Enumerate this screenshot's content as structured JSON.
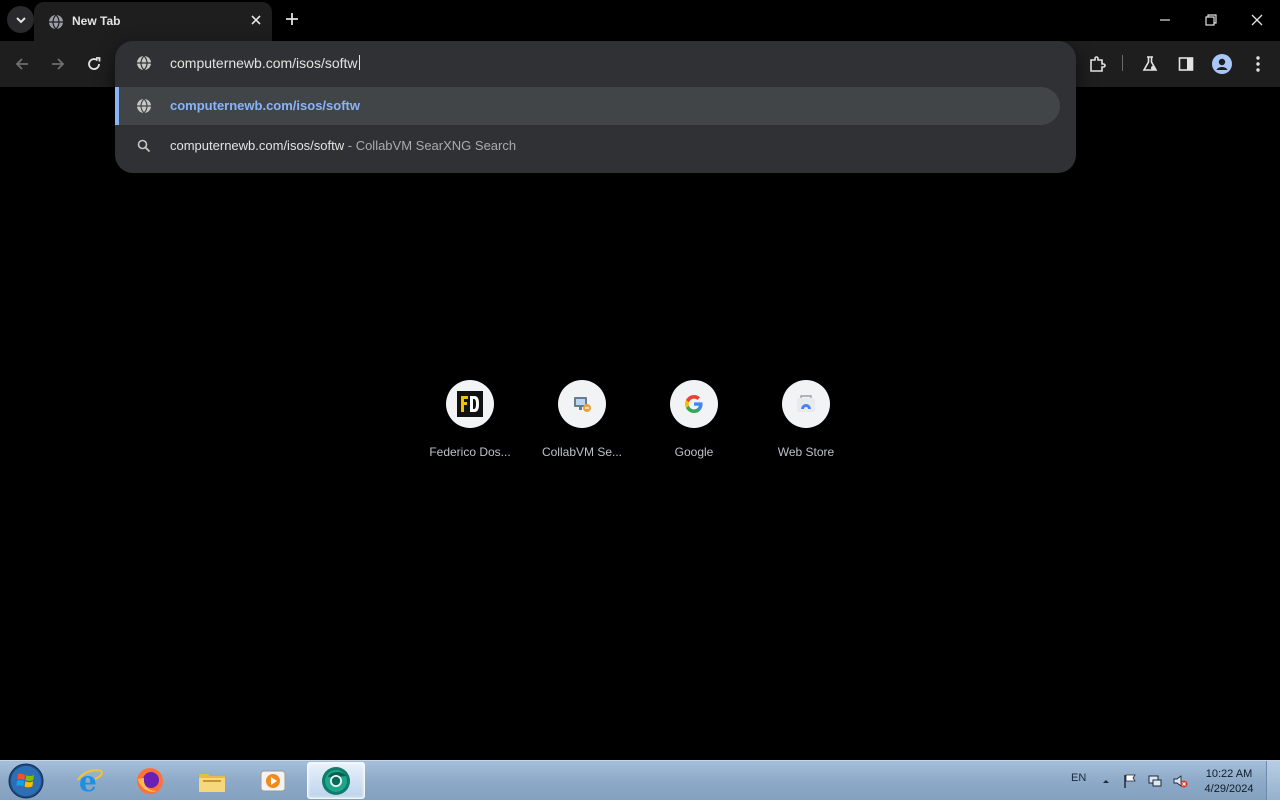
{
  "browser": {
    "tab": {
      "title": "New Tab",
      "favicon": "globe-icon"
    },
    "omnibox": {
      "typed_text": "computernewb.com/isos/softw",
      "suggestions": [
        {
          "kind": "url",
          "icon": "globe-icon",
          "text": "computernewb.com/isos/softw",
          "selected": true
        },
        {
          "kind": "search",
          "icon": "search-icon",
          "text": "computernewb.com/isos/softw",
          "separator": " - ",
          "description": "CollabVM SearXNG Search",
          "selected": false
        }
      ]
    },
    "shortcuts": [
      {
        "label": "Federico Dos...",
        "icon": "federico-dossena-logo-icon"
      },
      {
        "label": "CollabVM Se...",
        "icon": "collabvm-icon"
      },
      {
        "label": "Google",
        "icon": "google-icon"
      },
      {
        "label": "Web Store",
        "icon": "web-store-icon"
      }
    ],
    "colors": {
      "accent": "#8ab4f8",
      "popup_bg": "#303134",
      "toolbar_bg": "#1e1e1f"
    }
  },
  "taskbar": {
    "apps": [
      "internet-explorer-icon",
      "firefox-icon",
      "file-explorer-icon",
      "media-player-icon",
      "chrome-dev-icon"
    ],
    "language": "EN",
    "time": "10:22 AM",
    "date": "4/29/2024"
  }
}
